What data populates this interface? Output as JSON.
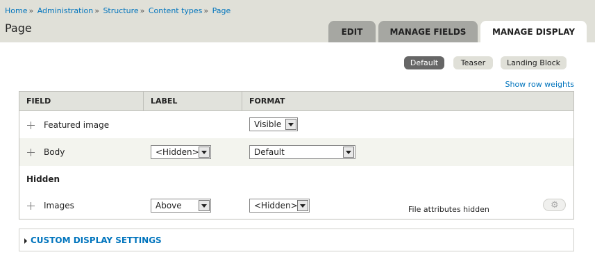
{
  "breadcrumb": {
    "items": [
      "Home",
      "Administration",
      "Structure",
      "Content types",
      "Page"
    ],
    "separator": "»"
  },
  "page_title": "Page",
  "tabs": [
    {
      "label": "EDIT",
      "active": false
    },
    {
      "label": "MANAGE FIELDS",
      "active": false
    },
    {
      "label": "MANAGE DISPLAY",
      "active": true
    }
  ],
  "view_modes": [
    {
      "label": "Default",
      "active": true
    },
    {
      "label": "Teaser",
      "active": false
    },
    {
      "label": "Landing Block",
      "active": false
    }
  ],
  "show_row_weights": "Show row weights",
  "table": {
    "headers": [
      "FIELD",
      "LABEL",
      "FORMAT"
    ],
    "rows": [
      {
        "field": "Featured image",
        "label": "",
        "format": "Visible"
      },
      {
        "field": "Body",
        "label": "<Hidden>",
        "format": "Default"
      }
    ],
    "hidden_section_label": "Hidden",
    "hidden_rows": [
      {
        "field": "Images",
        "label": "Above",
        "format": "<Hidden>",
        "summary": "File attributes hidden"
      }
    ]
  },
  "custom_display_settings": "CUSTOM DISPLAY SETTINGS",
  "colors": {
    "link": "#0074bd",
    "header_bg": "#e0e0d8",
    "tab_bg": "#a6a7a2",
    "active_pill": "#666666"
  },
  "icons": {
    "drag": "drag-handle-icon",
    "settings": "gear-icon",
    "expand": "triangle-right-icon"
  }
}
